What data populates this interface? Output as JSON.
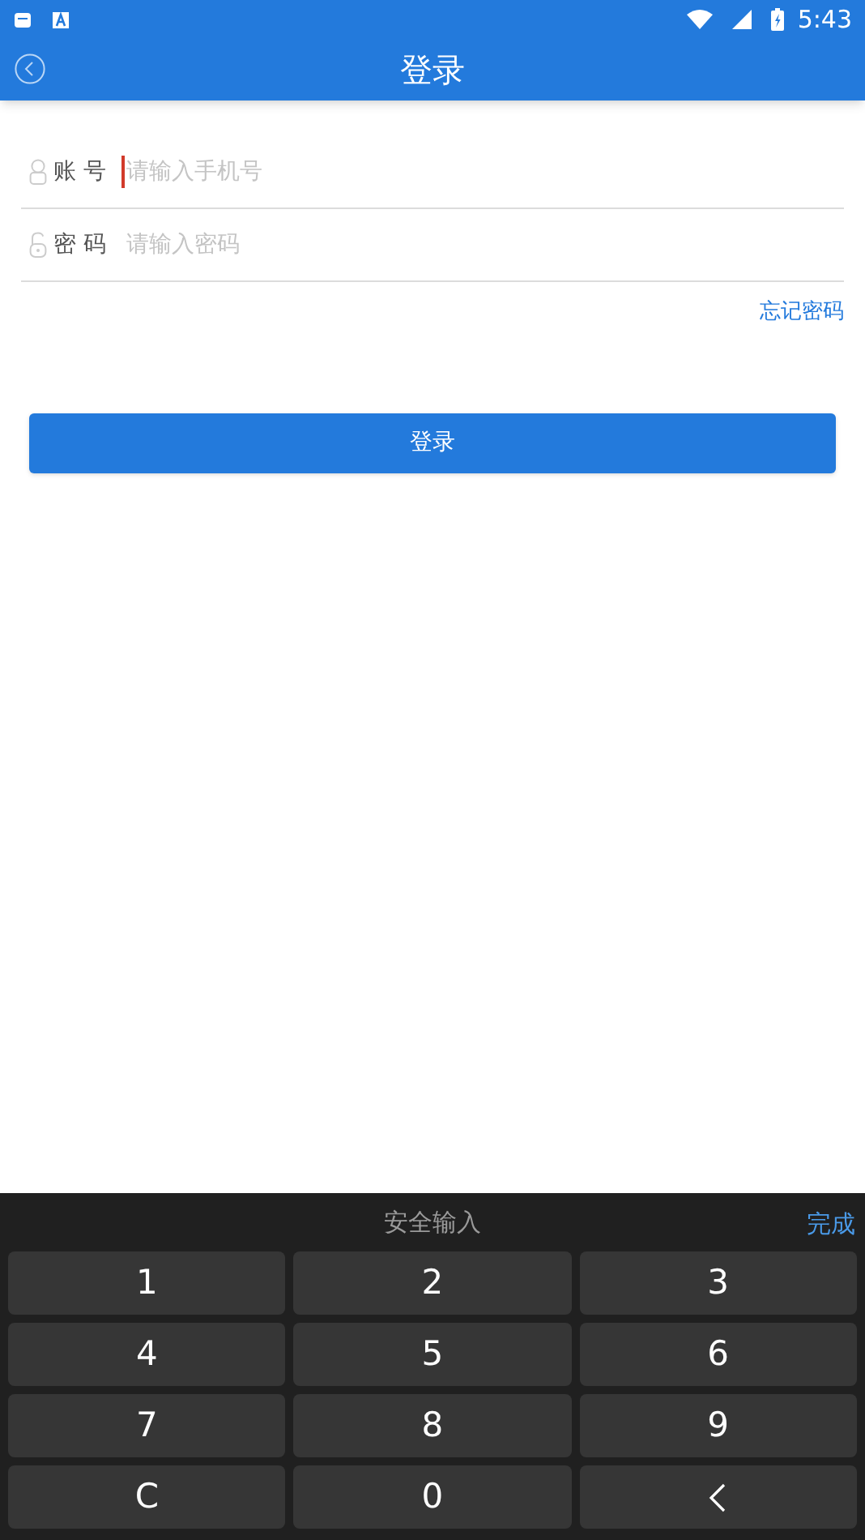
{
  "status_bar": {
    "time": "5:43"
  },
  "header": {
    "title": "登录"
  },
  "fields": [
    {
      "kind": "account",
      "label": "账 号",
      "placeholder": "请输入手机号",
      "focused": true
    },
    {
      "kind": "password",
      "label": "密 码",
      "placeholder": "请输入密码",
      "focused": false
    }
  ],
  "forgot_link": "忘记密码",
  "login_button": "登录",
  "keyboard": {
    "title": "安全输入",
    "done": "完成",
    "keys": [
      {
        "kind": "char",
        "label": "1"
      },
      {
        "kind": "char",
        "label": "2"
      },
      {
        "kind": "char",
        "label": "3"
      },
      {
        "kind": "char",
        "label": "4"
      },
      {
        "kind": "char",
        "label": "5"
      },
      {
        "kind": "char",
        "label": "6"
      },
      {
        "kind": "char",
        "label": "7"
      },
      {
        "kind": "char",
        "label": "8"
      },
      {
        "kind": "char",
        "label": "9"
      },
      {
        "kind": "char",
        "label": "C"
      },
      {
        "kind": "char",
        "label": "0"
      },
      {
        "kind": "backspace"
      }
    ]
  }
}
